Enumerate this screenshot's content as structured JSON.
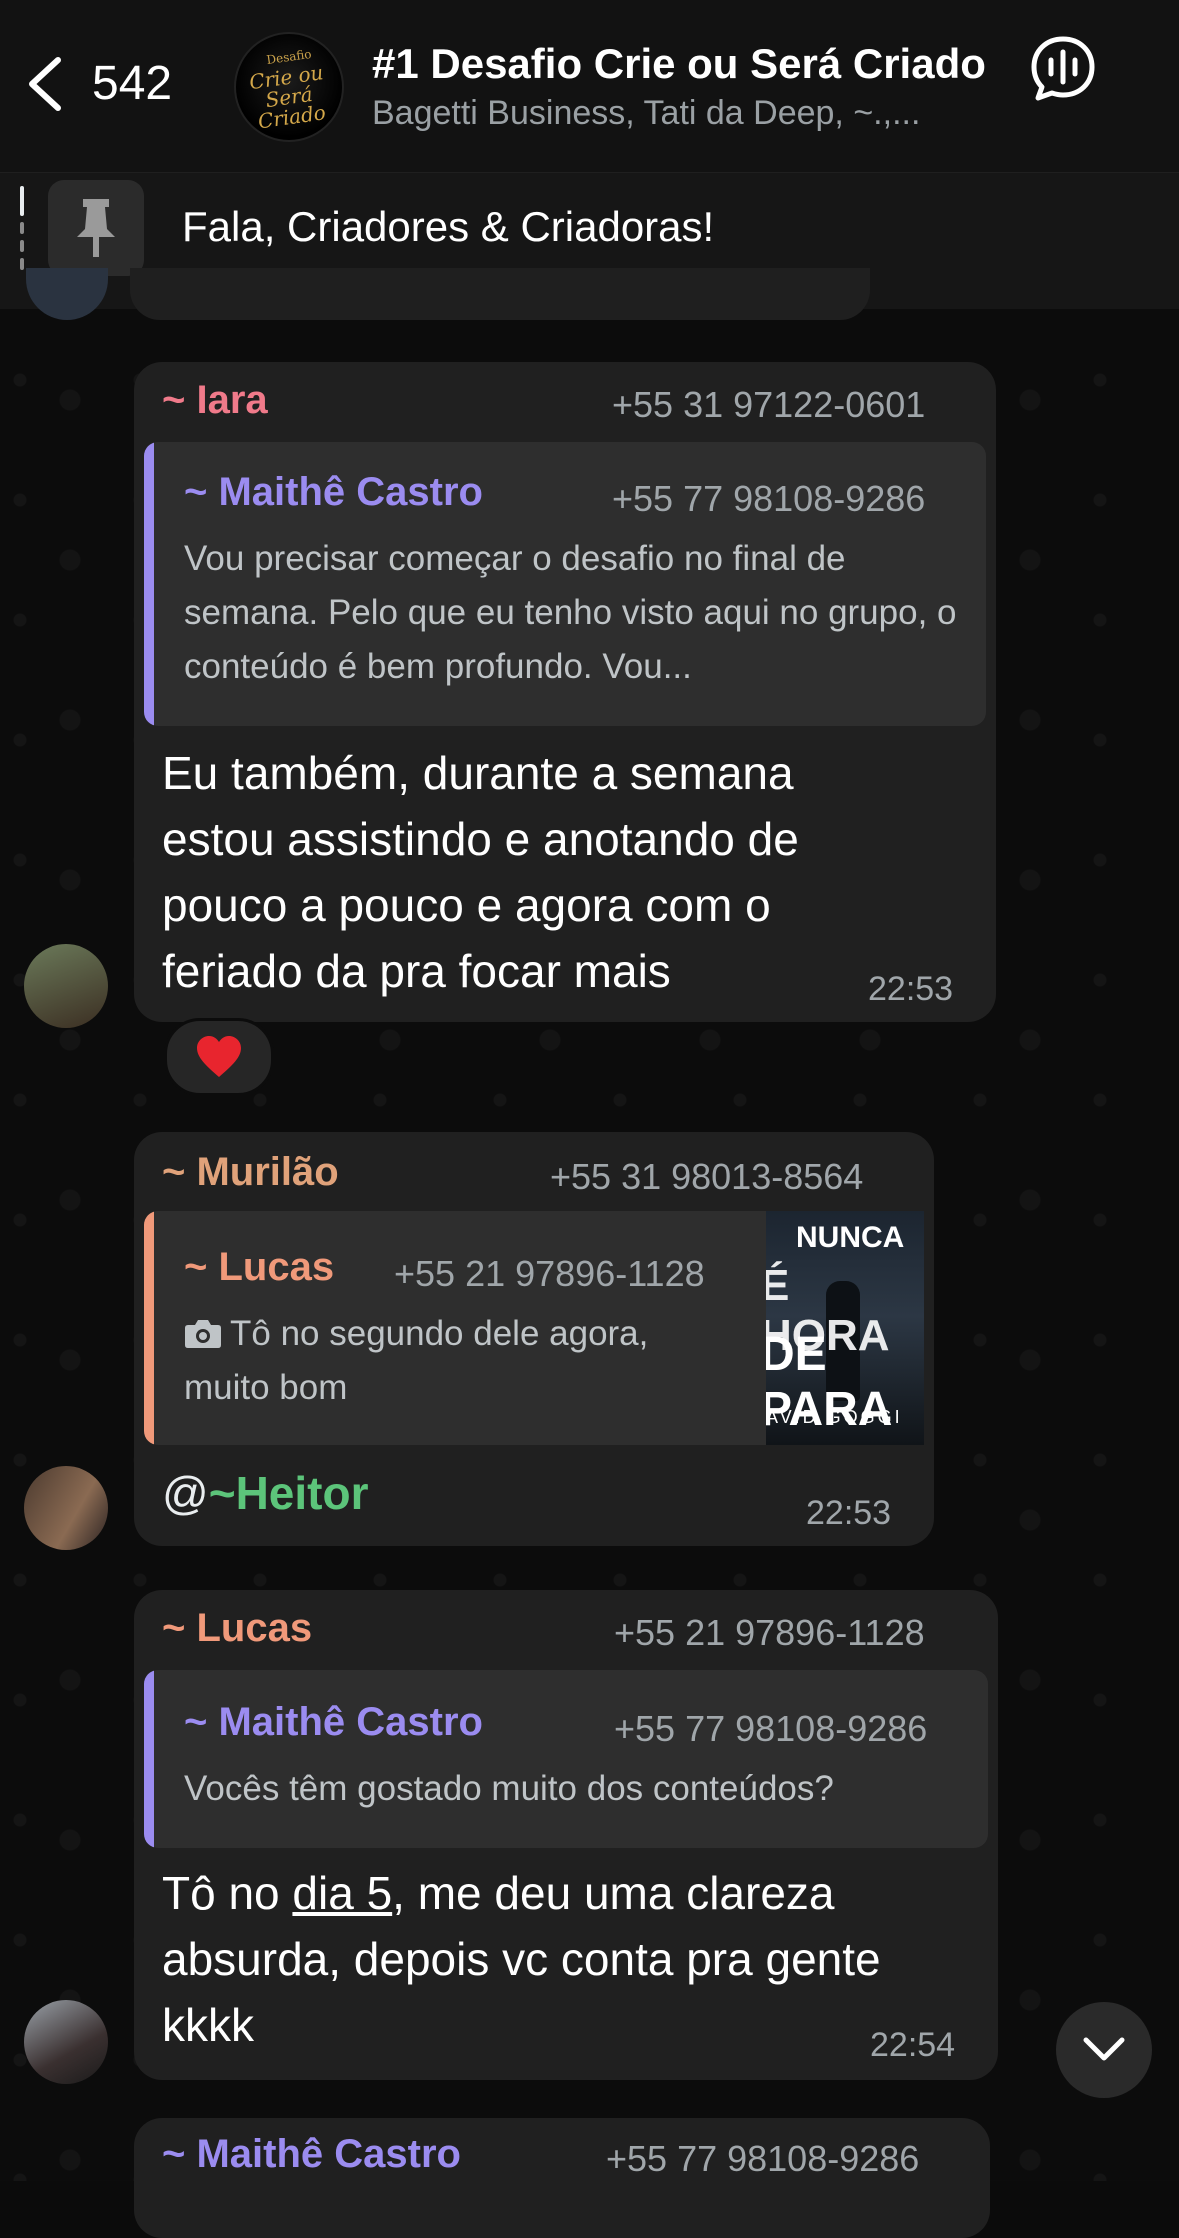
{
  "header": {
    "back_count": "542",
    "group_title": "#1 Desafio Crie ou Será Criado",
    "group_members": "Bagetti Business, Tati da Deep, ~.,...",
    "avatar_text_small": "Desafio",
    "avatar_text_main": "Crie ou Será Criado"
  },
  "pinned": {
    "text": "Fala, Criadores & Criadoras!"
  },
  "messages": [
    {
      "sender": "~ Iara",
      "phone": "+55 31 97122-0601",
      "sender_color": "#f07a8a",
      "quote": {
        "sender": "~ Maithê Castro",
        "phone": "+55 77 98108-9286",
        "text": "Vou precisar começar o desafio no final de semana. Pelo que eu tenho visto aqui no grupo, o conteúdo é bem profundo. Vou...",
        "color": "#9b8cf0"
      },
      "text_lines": [
        "Eu também, durante a semana",
        "estou assistindo e anotando de",
        "pouco a pouco e agora com o",
        "feriado da pra focar mais"
      ],
      "time": "22:53",
      "reaction": "❤️"
    },
    {
      "sender": "~ Murilão",
      "phone": "+55 31 98013-8564",
      "sender_color": "#e0a27a",
      "quote": {
        "sender": "~ Lucas",
        "phone": "+55 21 97896-1128",
        "text_lines": [
          "Tô no segundo dele agora,",
          "muito bom"
        ],
        "color": "#f0997a",
        "thumb": [
          "NUNCA",
          "É HORA",
          "DE PARA",
          "AVID GOGGI"
        ]
      },
      "mention_prefix": "@",
      "mention": "~Heitor",
      "time": "22:53"
    },
    {
      "sender": "~ Lucas",
      "phone": "+55 21 97896-1128",
      "sender_color": "#f0997a",
      "quote": {
        "sender": "~ Maithê Castro",
        "phone": "+55 77 98108-9286",
        "text": "Vocês têm gostado muito dos conteúdos?",
        "color": "#9b8cf0"
      },
      "text_line1_pre": "Tô no ",
      "text_line1_link": "dia 5",
      "text_line1_post": ", me deu uma clareza",
      "text_lines": [
        "absurda, depois vc conta pra gente",
        "kkkk"
      ],
      "time": "22:54"
    },
    {
      "sender": "~ Maithê Castro",
      "phone": "+55 77 98108-9286",
      "sender_color": "#9b8cf0"
    }
  ],
  "icons": [
    "chevron-left-icon",
    "voice-chat-icon",
    "pin-icon",
    "camera-icon",
    "chevron-down-icon",
    "heart-icon"
  ]
}
